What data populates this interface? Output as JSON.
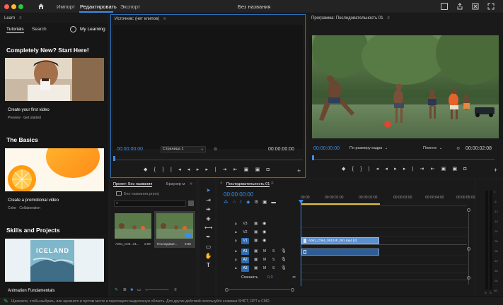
{
  "app": {
    "title": "Без названия",
    "nav": [
      "Импорт",
      "Редактировать",
      "Экспорт"
    ]
  },
  "learn": {
    "panel_title": "Learn",
    "tabs": [
      "Tutorials",
      "Search"
    ],
    "my_learning": "My Learning",
    "sections": [
      {
        "title": "Completely New? Start Here!",
        "card_title": "Create your first video",
        "card_sub": "Preview  ·  Get started"
      },
      {
        "title": "The Basics",
        "card_title": "Create a promotional video",
        "card_sub": "Color  ·  Collaboration"
      },
      {
        "title": "Skills and Projects",
        "card_title": "Animation Fundamentals",
        "card_sub": ""
      }
    ],
    "iceland_text": "ICELAND"
  },
  "source_monitor": {
    "title": "Источник: (нет клипов)",
    "timecode_in": "00:00:00:00",
    "page_select": "Страница 1",
    "timecode_out": "00:00:00:00"
  },
  "program_monitor": {
    "title": "Программа: Последовательность 01",
    "timecode_in": "00:00:00:00",
    "fit_select": "По размеру кадра",
    "quality_select": "Полное",
    "timecode_out": "00:00:02:08"
  },
  "project": {
    "tab_project": "Проект: Без названия",
    "tab_browser": "Браузер м",
    "project_name": "Без названия.prproj",
    "items": [
      {
        "name": "A061_C06...01...",
        "duration": "2:08"
      },
      {
        "name": "Последоват...",
        "duration": "2:08"
      }
    ]
  },
  "timeline": {
    "title": "Последовательность 01",
    "timecode": "00:00:00:00",
    "ruler": [
      "00:00",
      "00:00:01:00",
      "00:00:02:00",
      "00:00:03:00",
      "00:00:04:00",
      "00:00:05:00"
    ],
    "video_tracks": [
      "V3",
      "V2",
      "V1"
    ],
    "audio_tracks": [
      "A1",
      "A2",
      "A3"
    ],
    "clip_name": "A061_C064_09124F_001.mp4 [V]",
    "mix_label": "Смешать",
    "mix_value": "0,0"
  },
  "meters": {
    "labels": [
      "0",
      "-6",
      "-12",
      "-18",
      "-24",
      "-30",
      "-36",
      "-42",
      "-48",
      "-54"
    ],
    "unit": "dB"
  },
  "status_bar": {
    "text": "Щелкните, чтобы выбрать, или щелкните в пустом месте и перетащите выделенную область. Для других действий используйте клавиши SHIFT, OPT и CMD."
  },
  "colors": {
    "accent": "#3d8ee6",
    "clip_video": "#5b8fcf",
    "clip_audio": "#2e5d95",
    "playhead": "#3d8ee6"
  }
}
